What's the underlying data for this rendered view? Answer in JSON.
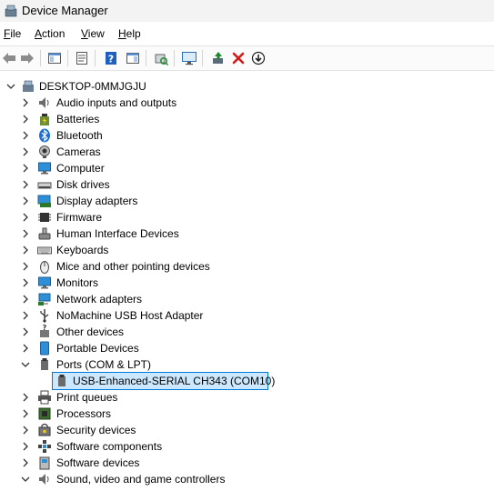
{
  "window": {
    "title": "Device Manager"
  },
  "menu": {
    "file": "File",
    "action": "Action",
    "view": "View",
    "help": "Help"
  },
  "tree": {
    "root": "DESKTOP-0MMJGJU",
    "items": [
      {
        "label": "Audio inputs and outputs",
        "icon": "speaker-icon"
      },
      {
        "label": "Batteries",
        "icon": "battery-icon"
      },
      {
        "label": "Bluetooth",
        "icon": "bluetooth-icon"
      },
      {
        "label": "Cameras",
        "icon": "camera-icon"
      },
      {
        "label": "Computer",
        "icon": "computer-icon"
      },
      {
        "label": "Disk drives",
        "icon": "disk-icon"
      },
      {
        "label": "Display adapters",
        "icon": "display-adapter-icon"
      },
      {
        "label": "Firmware",
        "icon": "chip-icon"
      },
      {
        "label": "Human Interface Devices",
        "icon": "hid-icon"
      },
      {
        "label": "Keyboards",
        "icon": "keyboard-icon"
      },
      {
        "label": "Mice and other pointing devices",
        "icon": "mouse-icon"
      },
      {
        "label": "Monitors",
        "icon": "monitor-icon"
      },
      {
        "label": "Network adapters",
        "icon": "network-icon"
      },
      {
        "label": "NoMachine USB Host Adapter",
        "icon": "usb-icon"
      },
      {
        "label": "Other devices",
        "icon": "unknown-device-icon"
      },
      {
        "label": "Portable Devices",
        "icon": "portable-device-icon"
      },
      {
        "label": "Ports (COM & LPT)",
        "icon": "port-icon",
        "expanded": true
      },
      {
        "label": "Print queues",
        "icon": "printer-icon"
      },
      {
        "label": "Processors",
        "icon": "processor-icon"
      },
      {
        "label": "Security devices",
        "icon": "security-icon"
      },
      {
        "label": "Software components",
        "icon": "software-component-icon"
      },
      {
        "label": "Software devices",
        "icon": "software-device-icon"
      },
      {
        "label": "Sound, video and game controllers",
        "icon": "sound-icon",
        "expanded": true
      }
    ],
    "child_selected": "USB-Enhanced-SERIAL CH343 (COM10)"
  },
  "colors": {
    "selection_fill": "#cce8ff",
    "selection_border": "#0078d7",
    "delete_red": "#d11a1a",
    "accent_green": "#1a8a2e"
  }
}
